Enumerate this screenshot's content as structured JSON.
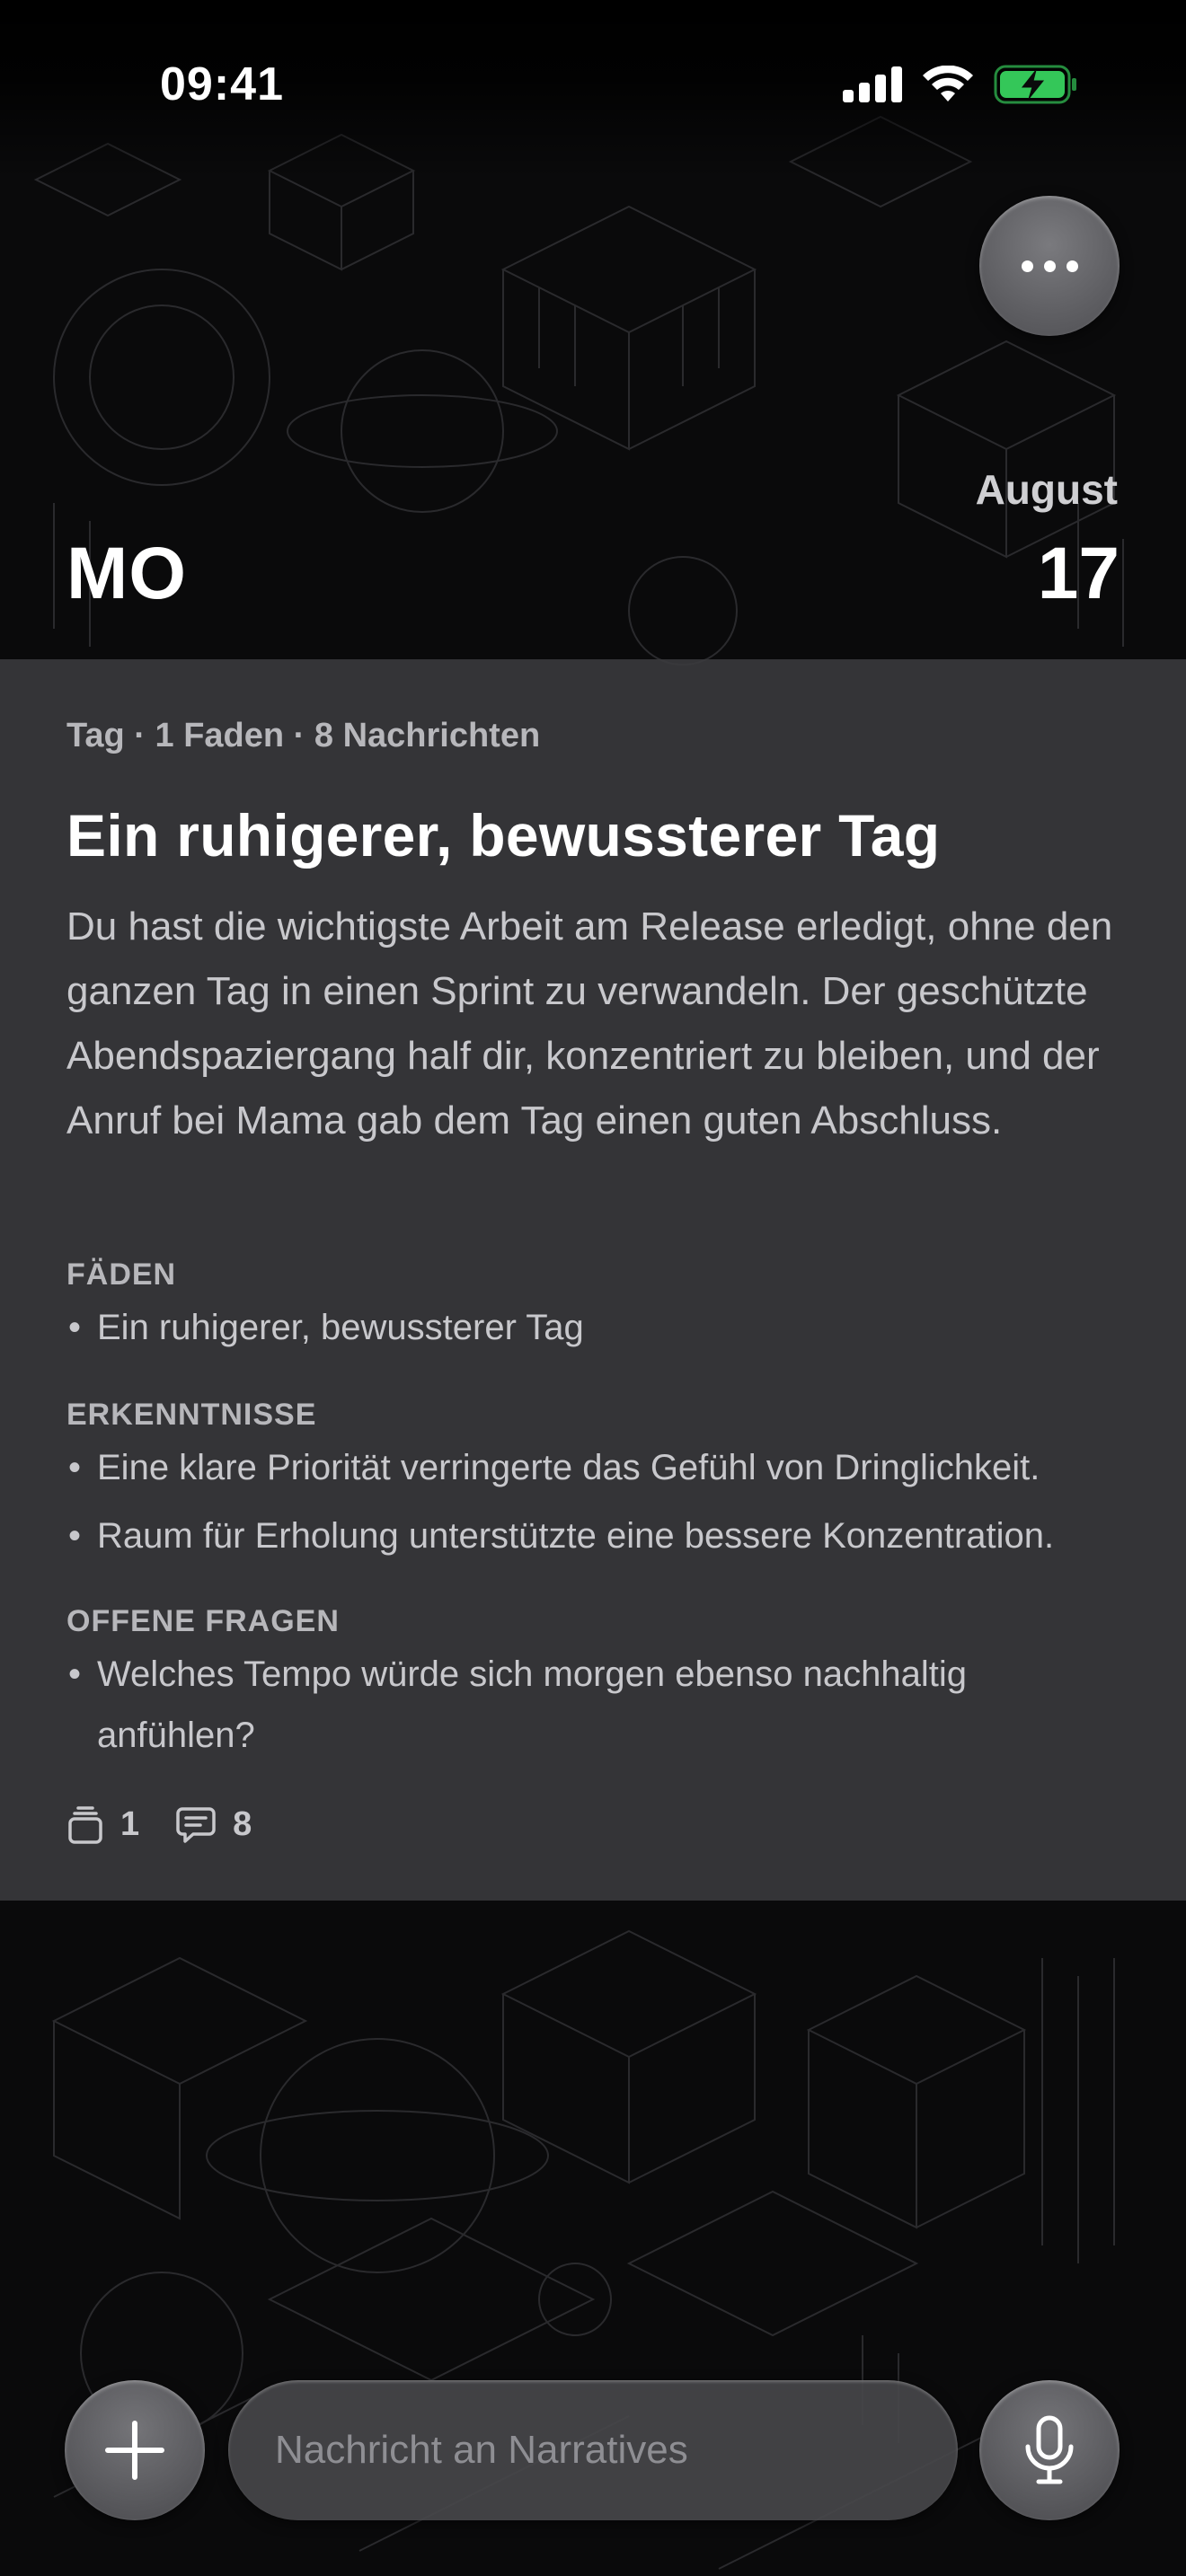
{
  "status_bar": {
    "time": "09:41",
    "signal_icon": "cellular-signal-icon",
    "wifi_icon": "wifi-icon",
    "battery_icon": "battery-charging-icon",
    "battery_color": "#34c759"
  },
  "header": {
    "more_icon": "ellipsis-icon",
    "weekday": "MO",
    "month": "August",
    "day": "17"
  },
  "summary": {
    "meta": "Tag · 1 Faden · 8 Nachrichten",
    "title": "Ein ruhigerer, bewussterer Tag",
    "body": "Du hast die wichtigste Arbeit am Release erledigt, ohne den ganzen Tag in einen Sprint zu verwandeln. Der geschützte Abendspaziergang half dir, konzentriert zu bleiben, und der Anruf bei Mama gab dem Tag einen guten Abschluss.",
    "sections": {
      "threads": {
        "heading": "FÄDEN",
        "items": [
          "Ein ruhigerer, bewussterer Tag"
        ]
      },
      "insights": {
        "heading": "ERKENNTNISSE",
        "items": [
          "Eine klare Priorität verringerte das Gefühl von Dringlichkeit.",
          "Raum für Erholung unterstützte eine bessere Konzentration."
        ]
      },
      "open_questions": {
        "heading": "OFFENE FRAGEN",
        "items": [
          "Welches Tempo würde sich morgen ebenso nachhaltig anfühlen?"
        ]
      }
    },
    "bullet_char": "•",
    "counts": {
      "threads_icon": "stack-icon",
      "threads": "1",
      "messages_icon": "chat-bubble-icon",
      "messages": "8"
    }
  },
  "composer": {
    "add_icon": "plus-icon",
    "placeholder": "Nachricht an Narratives",
    "value": "",
    "mic_icon": "microphone-icon"
  }
}
